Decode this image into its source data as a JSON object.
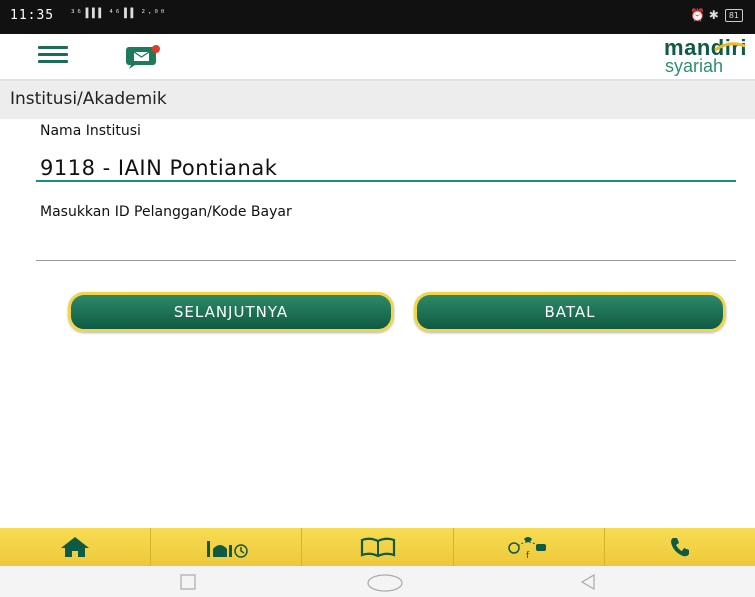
{
  "status_bar": {
    "time": "11:35",
    "signal_text": "³⁶▐▐▐ ⁴⁶▐▐ ²·⁰⁰",
    "right_icons": "⏰ ✱",
    "battery": "81"
  },
  "header": {
    "logo_line1": "mandiri",
    "logo_line2": "syariah"
  },
  "section": {
    "title": "Institusi/Akademik"
  },
  "form": {
    "institution_label": "Nama Institusi",
    "institution_value": "9118 - IAIN Pontianak",
    "customer_id_label": "Masukkan ID Pelanggan/Kode Bayar",
    "customer_id_value": ""
  },
  "buttons": {
    "next_label": "SELANJUTNYA",
    "cancel_label": "BATAL"
  },
  "bottom_nav": {
    "items": [
      "home-icon",
      "mosque-icon",
      "book-icon",
      "social-media-icon",
      "phone-icon"
    ]
  },
  "colors": {
    "brand_green": "#0f5a43",
    "accent_yellow": "#f2d44b",
    "underline_active": "#1f8a8a"
  }
}
